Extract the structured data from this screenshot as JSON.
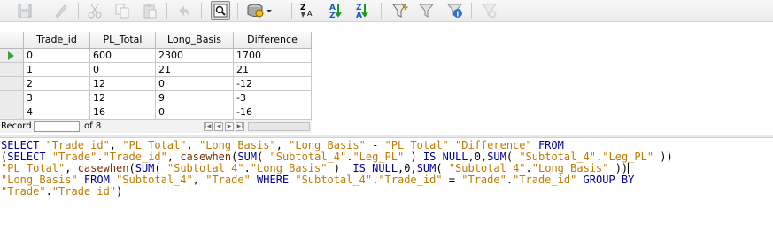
{
  "toolbar": {
    "buttons": [
      {
        "icon": "save-icon",
        "enabled": false
      },
      {
        "icon": "edit-icon",
        "enabled": false
      },
      {
        "icon": "cut-icon",
        "enabled": false
      },
      {
        "icon": "copy-icon",
        "enabled": false
      },
      {
        "icon": "paste-icon",
        "enabled": false
      },
      {
        "icon": "undo-icon",
        "enabled": false
      },
      {
        "icon": "design-view-icon",
        "enabled": true,
        "pressed": true
      },
      {
        "icon": "run-query-icon",
        "enabled": true
      },
      {
        "icon": "sort-icon",
        "enabled": true
      },
      {
        "icon": "sort-ascending-icon",
        "enabled": true
      },
      {
        "icon": "sort-descending-icon",
        "enabled": true
      },
      {
        "icon": "autofilter-icon",
        "enabled": true
      },
      {
        "icon": "apply-filter-icon",
        "enabled": true
      },
      {
        "icon": "standard-filter-icon",
        "enabled": true
      },
      {
        "icon": "remove-filter-icon",
        "enabled": false
      }
    ]
  },
  "grid": {
    "columns": [
      "Trade_id",
      "PL_Total",
      "Long_Basis",
      "Difference"
    ],
    "rows": [
      [
        "0",
        "600",
        "2300",
        "1700"
      ],
      [
        "1",
        "0",
        "21",
        "21"
      ],
      [
        "2",
        "12",
        "0",
        "-12"
      ],
      [
        "3",
        "12",
        "9",
        "-3"
      ],
      [
        "4",
        "16",
        "0",
        "-16"
      ]
    ],
    "current_row": 0
  },
  "record_nav": {
    "label": "Record",
    "value": "",
    "of_text": "of 8",
    "buttons": [
      "|◀",
      "◀",
      "▶",
      "▶|"
    ]
  },
  "sql": {
    "lines": [
      [
        {
          "t": "SELECT ",
          "c": "kw"
        },
        {
          "t": "\"Trade_id\"",
          "c": "str"
        },
        {
          "t": ", ",
          "c": "txt"
        },
        {
          "t": "\"PL_Total\"",
          "c": "str"
        },
        {
          "t": ", ",
          "c": "txt"
        },
        {
          "t": "\"Long_Basis\"",
          "c": "str"
        },
        {
          "t": ", ",
          "c": "txt"
        },
        {
          "t": "\"Long_Basis\"",
          "c": "str"
        },
        {
          "t": " - ",
          "c": "txt"
        },
        {
          "t": "\"PL_Total\"",
          "c": "str"
        },
        {
          "t": " ",
          "c": "txt"
        },
        {
          "t": "\"Difference\"",
          "c": "str"
        },
        {
          "t": " FROM",
          "c": "kw"
        }
      ],
      [
        {
          "t": "(",
          "c": "txt"
        },
        {
          "t": "SELECT ",
          "c": "kw"
        },
        {
          "t": "\"Trade\"",
          "c": "str"
        },
        {
          "t": ".",
          "c": "txt"
        },
        {
          "t": "\"Trade_id\"",
          "c": "str"
        },
        {
          "t": ", ",
          "c": "txt"
        },
        {
          "t": "casewhen",
          "c": "fn"
        },
        {
          "t": "(",
          "c": "txt"
        },
        {
          "t": "SUM",
          "c": "kw"
        },
        {
          "t": "( ",
          "c": "txt"
        },
        {
          "t": "\"Subtotal_4\"",
          "c": "str"
        },
        {
          "t": ".",
          "c": "txt"
        },
        {
          "t": "\"Leg_PL\"",
          "c": "str"
        },
        {
          "t": " ) ",
          "c": "txt"
        },
        {
          "t": "IS NULL",
          "c": "kw"
        },
        {
          "t": ",0,",
          "c": "txt"
        },
        {
          "t": "SUM",
          "c": "kw"
        },
        {
          "t": "( ",
          "c": "txt"
        },
        {
          "t": "\"Subtotal_4\"",
          "c": "str"
        },
        {
          "t": ".",
          "c": "txt"
        },
        {
          "t": "\"Leg_PL\"",
          "c": "str"
        },
        {
          "t": " ))",
          "c": "txt"
        }
      ],
      [
        {
          "t": "\"PL_Total\"",
          "c": "str"
        },
        {
          "t": ", ",
          "c": "txt"
        },
        {
          "t": "casewhen",
          "c": "fn"
        },
        {
          "t": "(",
          "c": "txt"
        },
        {
          "t": "SUM",
          "c": "kw"
        },
        {
          "t": "( ",
          "c": "txt"
        },
        {
          "t": "\"Subtotal_4\"",
          "c": "str"
        },
        {
          "t": ".",
          "c": "txt"
        },
        {
          "t": "\"Long_Basis\"",
          "c": "str"
        },
        {
          "t": " )  ",
          "c": "txt"
        },
        {
          "t": "IS NULL",
          "c": "kw"
        },
        {
          "t": ",0,",
          "c": "txt"
        },
        {
          "t": "SUM",
          "c": "kw"
        },
        {
          "t": "( ",
          "c": "txt"
        },
        {
          "t": "\"Subtotal_4\"",
          "c": "str"
        },
        {
          "t": ".",
          "c": "txt"
        },
        {
          "t": "\"Long_Basis\"",
          "c": "str"
        },
        {
          "t": " ))",
          "c": "txt"
        },
        {
          "t": "",
          "c": "caret"
        }
      ],
      [
        {
          "t": "\"Long_Basis\"",
          "c": "str"
        },
        {
          "t": " FROM ",
          "c": "kw"
        },
        {
          "t": "\"Subtotal_4\"",
          "c": "str"
        },
        {
          "t": ", ",
          "c": "txt"
        },
        {
          "t": "\"Trade\"",
          "c": "str"
        },
        {
          "t": " WHERE ",
          "c": "kw"
        },
        {
          "t": "\"Subtotal_4\"",
          "c": "str"
        },
        {
          "t": ".",
          "c": "txt"
        },
        {
          "t": "\"Trade_id\"",
          "c": "str"
        },
        {
          "t": " = ",
          "c": "txt"
        },
        {
          "t": "\"Trade\"",
          "c": "str"
        },
        {
          "t": ".",
          "c": "txt"
        },
        {
          "t": "\"Trade_id\"",
          "c": "str"
        },
        {
          "t": " GROUP BY",
          "c": "kw"
        }
      ],
      [
        {
          "t": "\"Trade\"",
          "c": "str"
        },
        {
          "t": ".",
          "c": "txt"
        },
        {
          "t": "\"Trade_id\"",
          "c": "str"
        },
        {
          "t": ")",
          "c": "txt"
        }
      ]
    ]
  },
  "colors": {
    "keyword": "#000099",
    "string": "#bf7a00",
    "function": "#7a2e00",
    "current_row_arrow": "#3aa23a"
  }
}
